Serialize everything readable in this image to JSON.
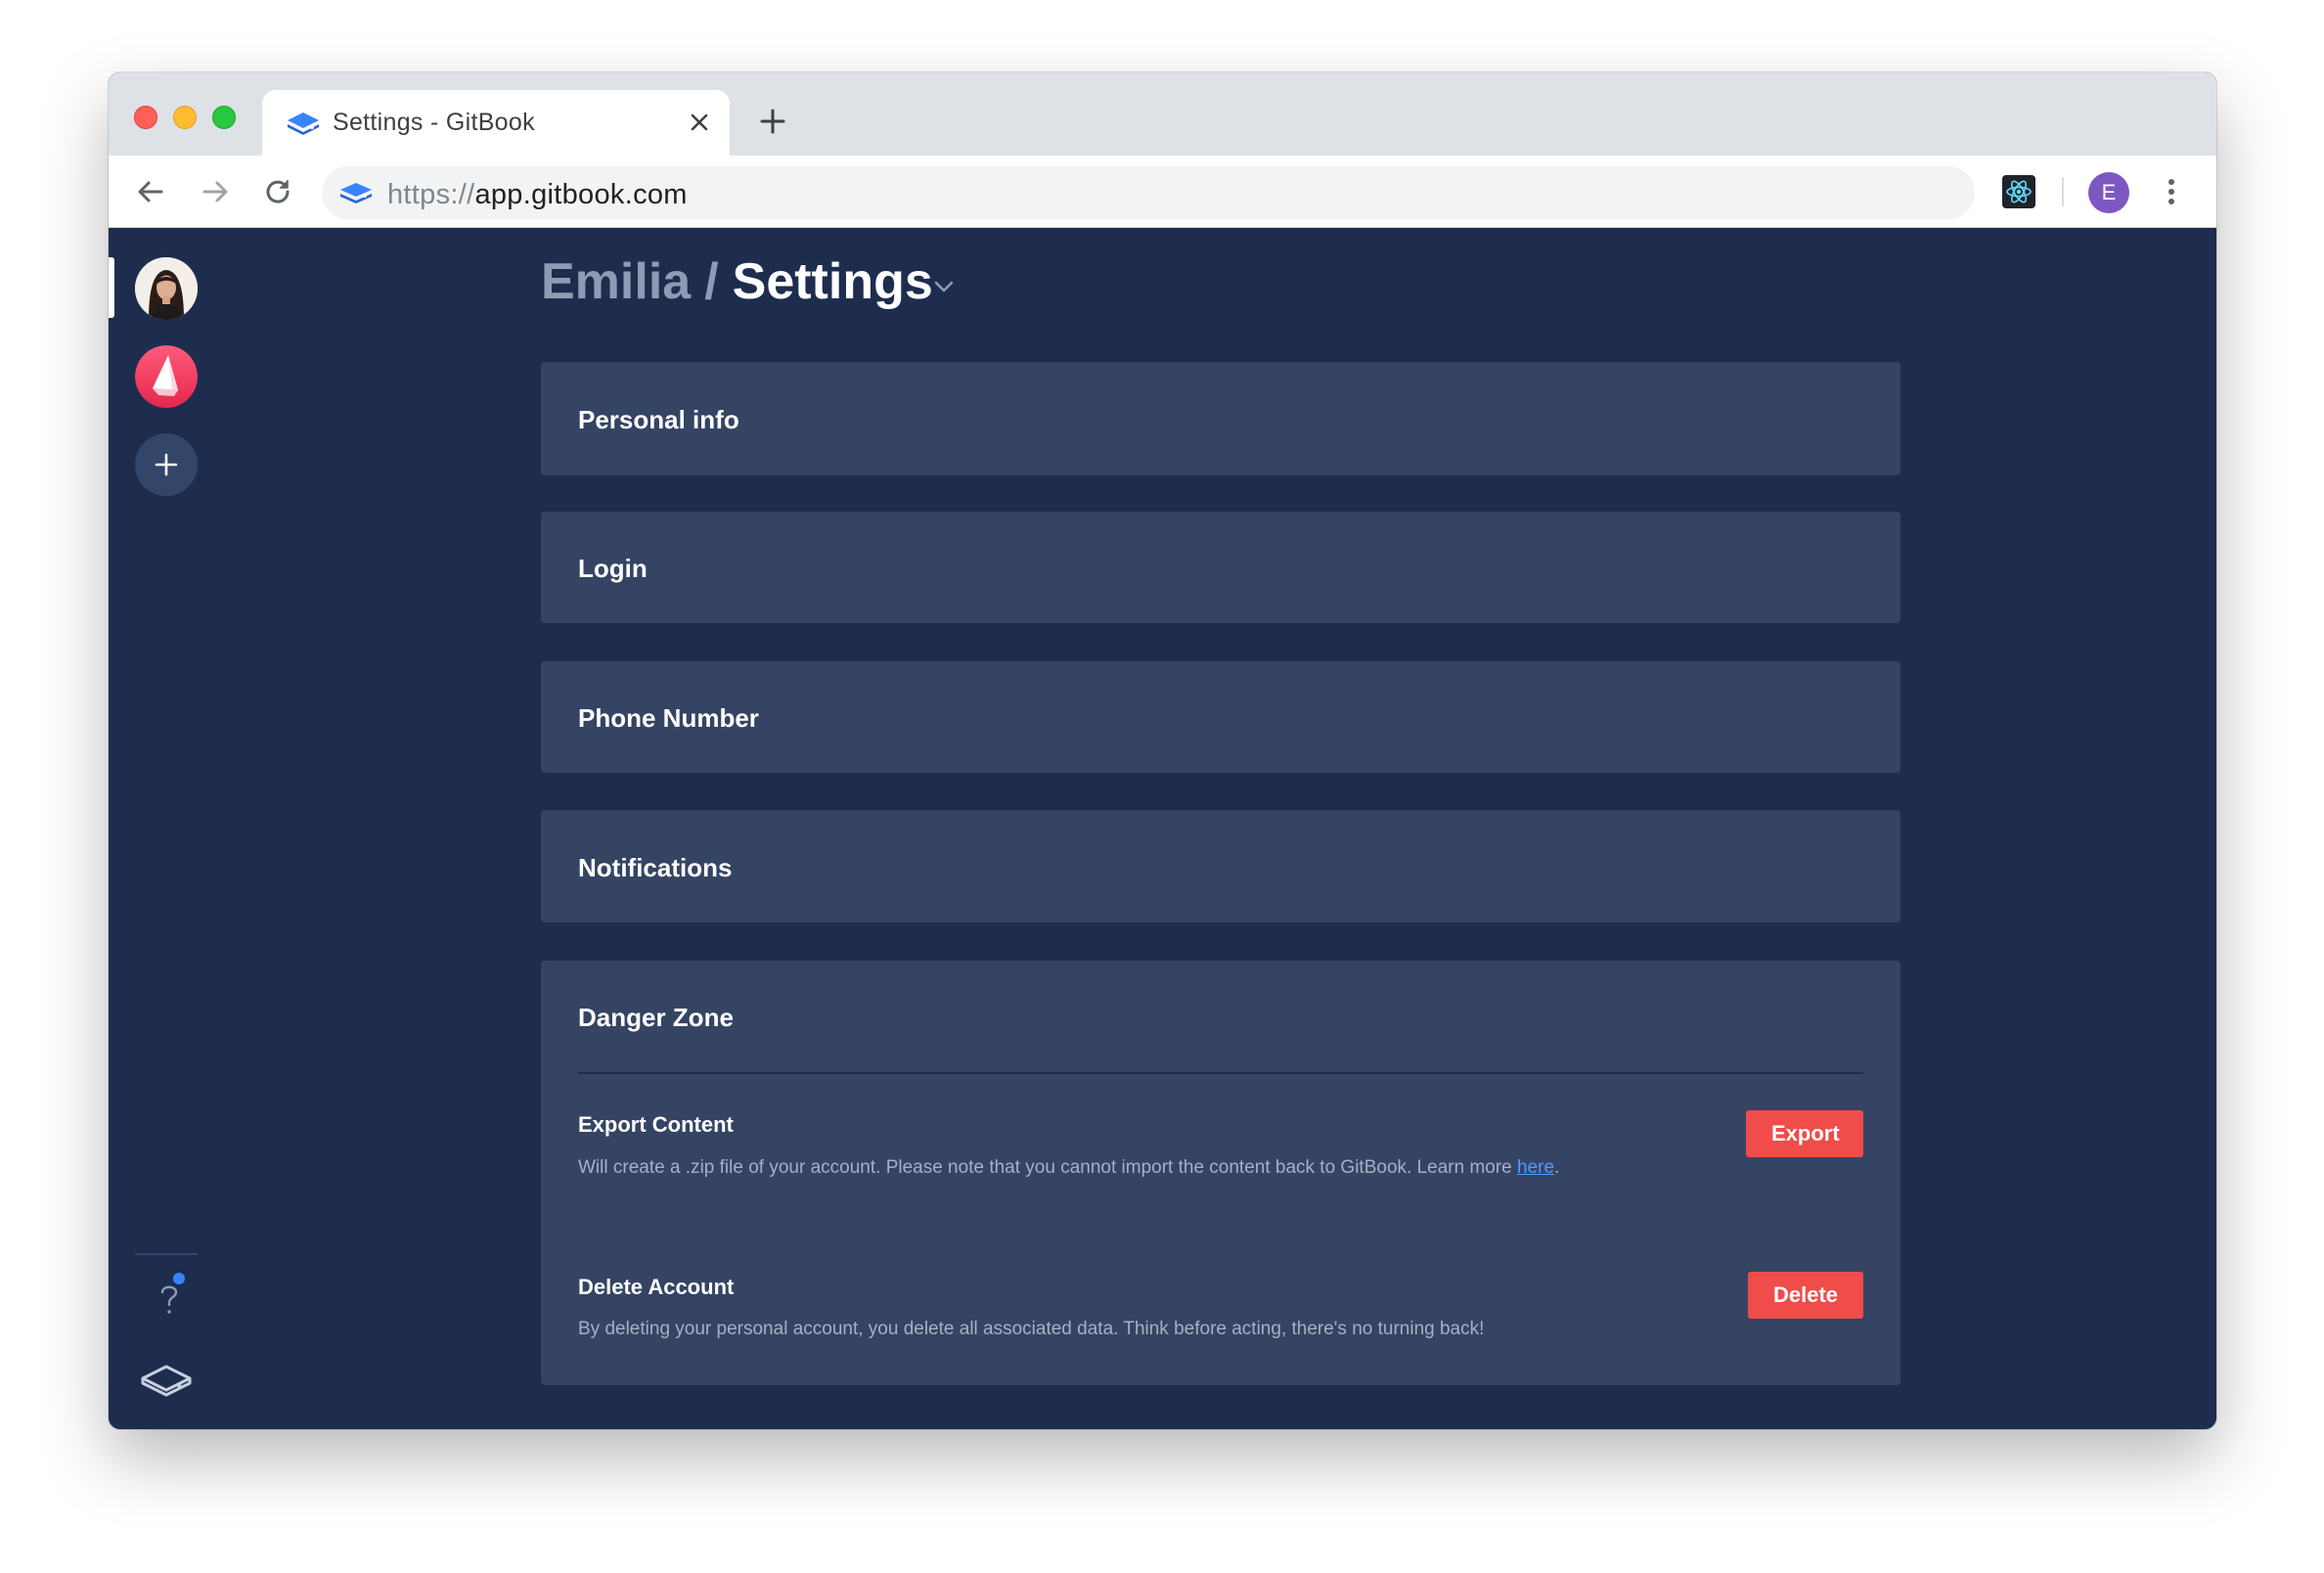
{
  "browser": {
    "tab_title": "Settings - GitBook",
    "url_scheme": "https://",
    "url_host": "app.gitbook.com",
    "profile_initial": "E"
  },
  "breadcrumb": {
    "owner": "Emilia",
    "separator": "/",
    "page": "Settings"
  },
  "sections": [
    {
      "label": "Personal info"
    },
    {
      "label": "Login"
    },
    {
      "label": "Phone Number"
    },
    {
      "label": "Notifications"
    }
  ],
  "danger_zone": {
    "title": "Danger Zone",
    "export": {
      "title": "Export Content",
      "description": "Will create a .zip file of your account. Please note that you cannot import the content back to GitBook. Learn more ",
      "link_text": "here",
      "suffix": ".",
      "button": "Export"
    },
    "delete": {
      "title": "Delete Account",
      "description": "By deleting your personal account, you delete all associated data. Think before acting, there's no turning back!",
      "button": "Delete"
    }
  },
  "colors": {
    "background": "#1e2d4e",
    "card": "#354463",
    "danger_button": "#ef4c4a",
    "link": "#4d9bff"
  },
  "icons": [
    "gitbook-favicon",
    "close-icon",
    "plus-icon",
    "back-arrow-icon",
    "forward-arrow-icon",
    "reload-icon",
    "react-devtools-icon",
    "kebab-menu-icon",
    "chevron-down-icon",
    "help-icon",
    "gitbook-logo-icon"
  ]
}
